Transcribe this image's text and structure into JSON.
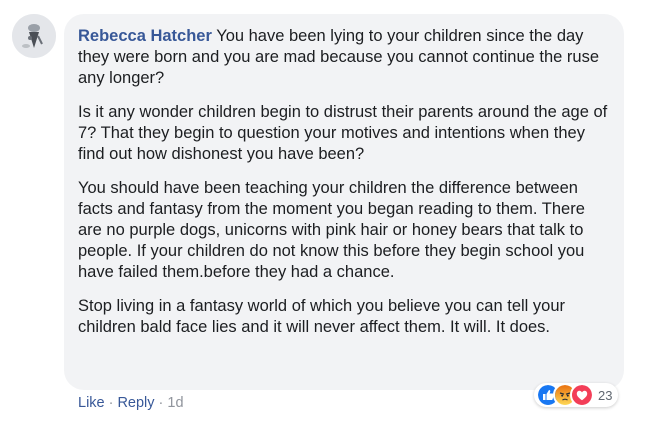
{
  "comment": {
    "author": "Rebecca Hatcher",
    "paragraphs": [
      "You have been lying to your children since the day they were born and you are mad because you cannot continue the ruse any longer?",
      "Is it any wonder children begin to distrust their parents around the age of 7? That they begin to question your motives and intentions when they find out how dishonest you have been?",
      "You should have been teaching your children the difference between facts and fantasy from the moment you began reading to them. There are no purple dogs, unicorns with pink hair or honey bears that talk to people. If your children do not know this before they begin school you have failed them.before they had a chance.",
      "Stop living in a fantasy world of which you believe you can tell your children bald face lies and it will never affect them. It will. It does."
    ],
    "reactions": {
      "icons": [
        "like-icon",
        "angry-icon",
        "love-icon"
      ],
      "count": "23"
    },
    "actions": {
      "like": "Like",
      "reply": "Reply",
      "separator": "·",
      "time": "1d"
    }
  },
  "colors": {
    "author": "#385898",
    "bubble": "#f2f3f5",
    "like": "#1877f2",
    "angry": "#f7714c",
    "love": "#f33e58"
  }
}
